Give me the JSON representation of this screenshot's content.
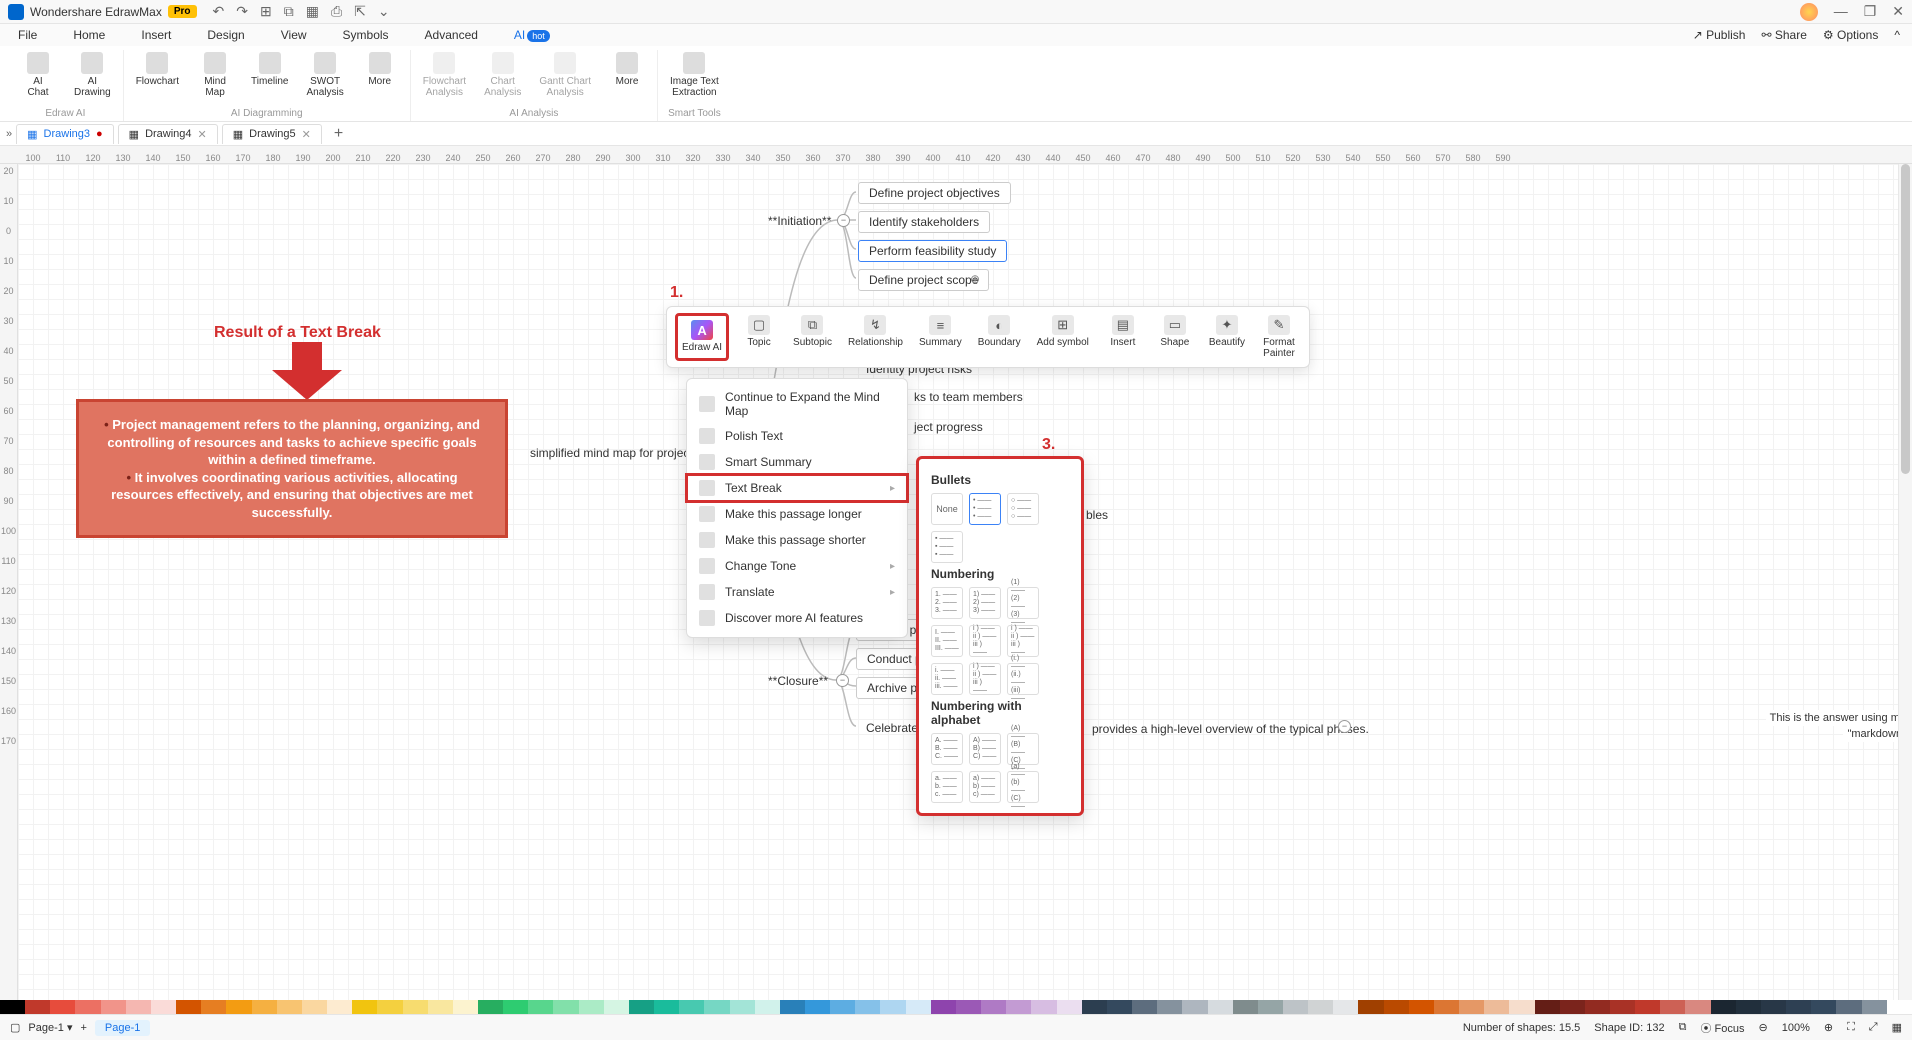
{
  "titlebar": {
    "app_name": "Wondershare EdrawMax",
    "pro_badge": "Pro",
    "qat": {
      "undo": "↶",
      "redo": "↷",
      "new": "⊞",
      "open": "⧉",
      "save": "▦",
      "print": "⎙",
      "export": "⇱",
      "more": "⌄"
    },
    "win": {
      "min": "—",
      "max": "❐",
      "close": "✕"
    }
  },
  "menubar": {
    "tabs": [
      "File",
      "Home",
      "Insert",
      "Design",
      "View",
      "Symbols",
      "Advanced",
      "AI"
    ],
    "hot_badge": "hot",
    "publish": "Publish",
    "share": "Share",
    "options": "Options"
  },
  "ribbon": {
    "edraw_ai": {
      "ai_chat": "AI\nChat",
      "ai_drawing": "AI\nDrawing",
      "group": "Edraw AI"
    },
    "ai_diagramming": {
      "flowchart": "Flowchart",
      "mindmap": "Mind\nMap",
      "timeline": "Timeline",
      "swot": "SWOT\nAnalysis",
      "more": "More",
      "group": "AI Diagramming"
    },
    "ai_analysis": {
      "flowchart_a": "Flowchart\nAnalysis",
      "chart_a": "Chart\nAnalysis",
      "gantt_a": "Gantt Chart\nAnalysis",
      "more": "More",
      "group": "AI Analysis"
    },
    "smart_tools": {
      "img_text": "Image Text\nExtraction",
      "group": "Smart Tools"
    }
  },
  "doctabs": {
    "t1": "Drawing3",
    "t2": "Drawing4",
    "t3": "Drawing5"
  },
  "ruler_h": [
    "100",
    "110",
    "120",
    "130",
    "140",
    "150",
    "160",
    "170",
    "180",
    "190",
    "200",
    "210",
    "220",
    "230",
    "240",
    "250",
    "260",
    "270",
    "280",
    "290",
    "300",
    "310",
    "320",
    "330",
    "340",
    "350",
    "360",
    "370",
    "380",
    "390",
    "400",
    "410",
    "420",
    "430",
    "440",
    "450",
    "460",
    "470",
    "480",
    "490",
    "500",
    "510",
    "520",
    "530",
    "540",
    "550",
    "560",
    "570",
    "580",
    "590"
  ],
  "ruler_v": [
    "20",
    "10",
    "0",
    "10",
    "20",
    "30",
    "40",
    "50",
    "60",
    "70",
    "80",
    "90",
    "100",
    "110",
    "120",
    "130",
    "140",
    "150",
    "160",
    "170"
  ],
  "mindmap": {
    "root": "simplified mind map for project ma",
    "initiation": "**Initiation**",
    "n1": "Define project objectives",
    "n2": "Identify stakeholders",
    "n3": "Perform feasibility study",
    "n4": "Define project scope",
    "n5": "Identity project risks",
    "n6": "ks to team members",
    "n7": "ject progress",
    "n8": "bles",
    "closure": "**Closure**",
    "c1": "Review projec",
    "c2": "Conduct proje",
    "c3": "Archive projec",
    "c4": "Celebrate pro",
    "tail1": "provides a high-level overview of the typical phases.",
    "tail2": "This is the answer using ma",
    "tail3": "\"markdown\""
  },
  "result": {
    "label": "Result of a Text Break",
    "line1": "Project management refers to the planning, organizing, and controlling of resources and tasks to achieve specific goals within a defined timeframe.",
    "line2": "It involves coordinating various activities, allocating resources effectively, and ensuring that objectives are met successfully."
  },
  "ftoolbar": {
    "edraw_ai": "Edraw AI",
    "topic": "Topic",
    "subtopic": "Subtopic",
    "relationship": "Relationship",
    "summary": "Summary",
    "boundary": "Boundary",
    "add_symbol": "Add symbol",
    "insert": "Insert",
    "shape": "Shape",
    "beautify": "Beautify",
    "format_painter": "Format\nPainter"
  },
  "aimenu": {
    "i1": "Continue to Expand the Mind Map",
    "i2": "Polish Text",
    "i3": "Smart Summary",
    "i4": "Text Break",
    "i5": "Make this passage longer",
    "i6": "Make this passage shorter",
    "i7": "Change Tone",
    "i8": "Translate",
    "i9": "Discover more AI features"
  },
  "submenu": {
    "h1": "Bullets",
    "none": "None",
    "h2": "Numbering",
    "h3": "Numbering with alphabet",
    "num_opts": [
      "1. ——\n2. ——\n3. ——",
      "1) ——\n2) ——\n3) ——",
      "(1) ——\n(2) ——\n(3) ——",
      "I. ——\nII. ——\nIII. ——",
      "i ) ——\nii ) ——\niii ) ——",
      "i ) ——\nii ) ——\niii ) ——",
      "i. ——\nii. ——\niii. ——",
      "i ) ——\nii ) ——\niii ) ——",
      "(i.) ——\n(ii.) ——\n(iii) ——"
    ],
    "alpha_opts": [
      "A. ——\nB. ——\nC. ——",
      "A) ——\nB) ——\nC) ——",
      "(A) ——\n(B) ——\n(C) ——",
      "a. ——\nb. ——\nc. ——",
      "a) ——\nb) ——\nc) ——",
      "(a) ——\n(b) ——\n(C) ——"
    ]
  },
  "annot": {
    "n1": "1.",
    "n2": "2.",
    "n3": "3."
  },
  "palette": [
    "#000000",
    "#c0392b",
    "#e74c3c",
    "#ec7063",
    "#f1948a",
    "#f5b7b1",
    "#fadbd8",
    "#d35400",
    "#e67e22",
    "#f39c12",
    "#f5b041",
    "#f8c471",
    "#fad7a0",
    "#fdebd0",
    "#f1c40f",
    "#f4d03f",
    "#f7dc6f",
    "#f9e79f",
    "#fcf3cf",
    "#27ae60",
    "#2ecc71",
    "#58d68d",
    "#82e0aa",
    "#abebc6",
    "#d5f5e3",
    "#16a085",
    "#1abc9c",
    "#48c9b0",
    "#76d7c4",
    "#a3e4d7",
    "#d1f2eb",
    "#2980b9",
    "#3498db",
    "#5dade2",
    "#85c1e9",
    "#aed6f1",
    "#d6eaf8",
    "#8e44ad",
    "#9b59b6",
    "#af7ac5",
    "#c39bd3",
    "#d7bde2",
    "#ebdef0",
    "#2c3e50",
    "#34495e",
    "#5d6d7e",
    "#85929e",
    "#aeb6bf",
    "#d6dbdf",
    "#7f8c8d",
    "#95a5a6",
    "#bdc3c7",
    "#d0d3d4",
    "#e5e7e9",
    "#a04000",
    "#ba4a00",
    "#d35400",
    "#dc7633",
    "#e59866",
    "#edbb99",
    "#f6ddcc",
    "#641e16",
    "#7b241c",
    "#922b21",
    "#a93226",
    "#c0392b",
    "#cd6155",
    "#d98880",
    "#1b2631",
    "#212f3c",
    "#283747",
    "#2e4053",
    "#34495e",
    "#5d6d7e",
    "#85929e",
    "#ffffff"
  ],
  "statusbar": {
    "page_label": "Page-1",
    "page_tab": "Page-1",
    "shapes": "Number of shapes: 15.5",
    "shape_id": "Shape ID: 132",
    "focus": "Focus",
    "zoom": "100%"
  }
}
